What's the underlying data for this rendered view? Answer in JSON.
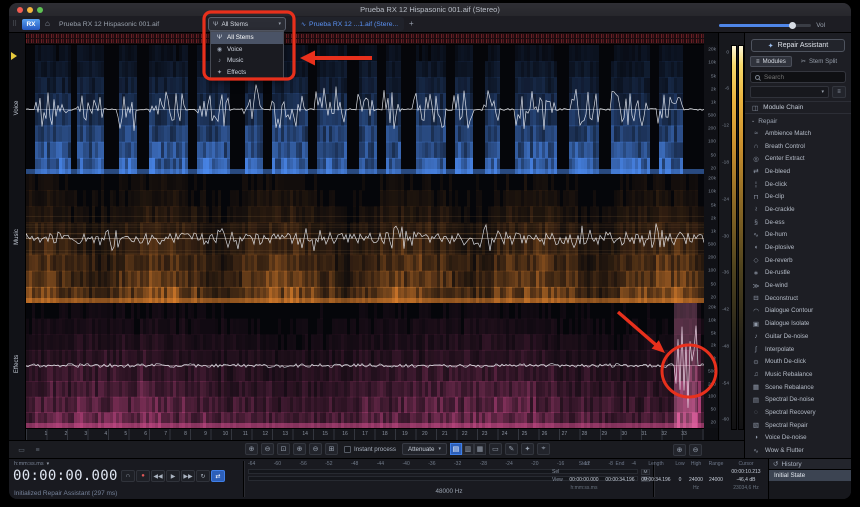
{
  "colors": {
    "accent": "#3f7fe8",
    "annotation": "#e8301c",
    "voice": "#4d8df5",
    "music": "#e8862e",
    "effects": "#d84f92"
  },
  "window": {
    "title": "Prueba RX 12 Hispasonic 001.aif (Stereo)"
  },
  "tab_bar": {
    "logo": "RX",
    "tab1": "Prueba RX 12 Hispasonic 001.aif",
    "tab2": "Prueba RX 12 ...1.aif (Stere...",
    "add_tab": "+",
    "vol_label": "Vol"
  },
  "stems": {
    "button_label": "All Stems",
    "menu": [
      {
        "icon": "Ψ",
        "label": "All Stems",
        "selected": true
      },
      {
        "icon": "◉",
        "label": "Voice",
        "selected": false
      },
      {
        "icon": "♪",
        "label": "Music",
        "selected": false
      },
      {
        "icon": "✦",
        "label": "Effects",
        "selected": false
      }
    ]
  },
  "tracks": [
    {
      "name": "Voice"
    },
    {
      "name": "Music"
    },
    {
      "name": "Effects"
    }
  ],
  "freq_labels": [
    "20k",
    "10k",
    "5k",
    "2k",
    "1k",
    "500",
    "200",
    "100",
    "50",
    "20"
  ],
  "meter_scale": [
    "0",
    "-6",
    "-12",
    "-18",
    "-24",
    "-30",
    "-36",
    "-42",
    "-48",
    "-54",
    "-60"
  ],
  "ruler_labels": [
    "1",
    "2",
    "3",
    "4",
    "5",
    "6",
    "7",
    "8",
    "9",
    "10",
    "11",
    "12",
    "13",
    "14",
    "15",
    "16",
    "17",
    "18",
    "19",
    "20",
    "21",
    "22",
    "23",
    "24",
    "25",
    "26",
    "27",
    "28",
    "29",
    "30",
    "31",
    "32",
    "33"
  ],
  "spec_toolbar": {
    "left_icons": [
      "▭",
      "≡"
    ],
    "zoom_icons": [
      "⊕",
      "⊖",
      "⊡",
      "⊕",
      "⊖",
      "⊞"
    ],
    "instant_process": "Instant process",
    "attenuate": "Attenuate",
    "view_icons": [
      "▤",
      "▥",
      "▦"
    ],
    "tool_icons": [
      "▭",
      "✎",
      "✦",
      "⌖"
    ],
    "right_icons": [
      "⊕",
      "⊖"
    ]
  },
  "right_panel": {
    "repair_assistant": "Repair Assistant",
    "modules_tab": "Modules",
    "stem_split_tab": "Stem Split",
    "search_placeholder": "Search",
    "module_chain": "Module Chain",
    "repair_section": "Repair",
    "modules": [
      {
        "icon": "≈",
        "label": "Ambience Match"
      },
      {
        "icon": "∩",
        "label": "Breath Control"
      },
      {
        "icon": "◎",
        "label": "Center Extract"
      },
      {
        "icon": "⇄",
        "label": "De-bleed"
      },
      {
        "icon": "¦",
        "label": "De-click"
      },
      {
        "icon": "⊓",
        "label": "De-clip"
      },
      {
        "icon": "≀",
        "label": "De-crackle"
      },
      {
        "icon": "§",
        "label": "De-ess"
      },
      {
        "icon": "∿",
        "label": "De-hum"
      },
      {
        "icon": "◖",
        "label": "De-plosive"
      },
      {
        "icon": "◇",
        "label": "De-reverb"
      },
      {
        "icon": "∗",
        "label": "De-rustle"
      },
      {
        "icon": "≫",
        "label": "De-wind"
      },
      {
        "icon": "⊟",
        "label": "Deconstruct"
      },
      {
        "icon": "◠",
        "label": "Dialogue Contour"
      },
      {
        "icon": "▣",
        "label": "Dialogue Isolate"
      },
      {
        "icon": "♪",
        "label": "Guitar De-noise"
      },
      {
        "icon": "∫",
        "label": "Interpolate"
      },
      {
        "icon": "⊙",
        "label": "Mouth De-click"
      },
      {
        "icon": "♫",
        "label": "Music Rebalance"
      },
      {
        "icon": "▦",
        "label": "Scene Rebalance"
      },
      {
        "icon": "▤",
        "label": "Spectral De-noise"
      },
      {
        "icon": "◌",
        "label": "Spectral Recovery"
      },
      {
        "icon": "▧",
        "label": "Spectral Repair"
      },
      {
        "icon": "◑",
        "label": "Voice De-noise"
      },
      {
        "icon": "∿",
        "label": "Wow & Flutter"
      }
    ]
  },
  "transport": {
    "time_format": "h:mm:ss.ms",
    "time": "00:00:00.000",
    "buttons": [
      {
        "name": "monitor",
        "glyph": "∩"
      },
      {
        "name": "record",
        "glyph": "●"
      },
      {
        "name": "skip-back",
        "glyph": "◀◀"
      },
      {
        "name": "play",
        "glyph": "▶"
      },
      {
        "name": "skip-forward",
        "glyph": "▶▶"
      },
      {
        "name": "loop",
        "glyph": "↻"
      },
      {
        "name": "follow-playhead",
        "glyph": "⇄"
      }
    ],
    "status": "Initialized Repair Assistant (297 ms)"
  },
  "bottom": {
    "sample_rate": "48000 Hz",
    "meter_numbers": [
      "-64",
      "-60",
      "-56",
      "-52",
      "-48",
      "-44",
      "-40",
      "-36",
      "-32",
      "-28",
      "-24",
      "-20",
      "-16",
      "-12",
      "-8",
      "-4"
    ],
    "meter_channel_labels": [
      "M",
      "M"
    ]
  },
  "selection_info": {
    "headers": [
      "Start",
      "End",
      "Length",
      "Low",
      "High",
      "Range",
      "Cursor"
    ],
    "sel_label": "Sel",
    "view_label": "View",
    "sel_row": [
      "",
      "",
      "",
      "",
      "",
      "",
      "00:00:10.213"
    ],
    "view_row": [
      "00:00:00.000",
      "00:00:34.196",
      "00:00:34.196",
      "0",
      "24000",
      "24000",
      "-46,4 dB"
    ],
    "units_row": [
      "h:mm:ss.ms",
      "",
      "",
      "",
      "Hz",
      "",
      "23034,6 Hz"
    ]
  },
  "history": {
    "title": "History",
    "items": [
      "Initial State"
    ]
  }
}
